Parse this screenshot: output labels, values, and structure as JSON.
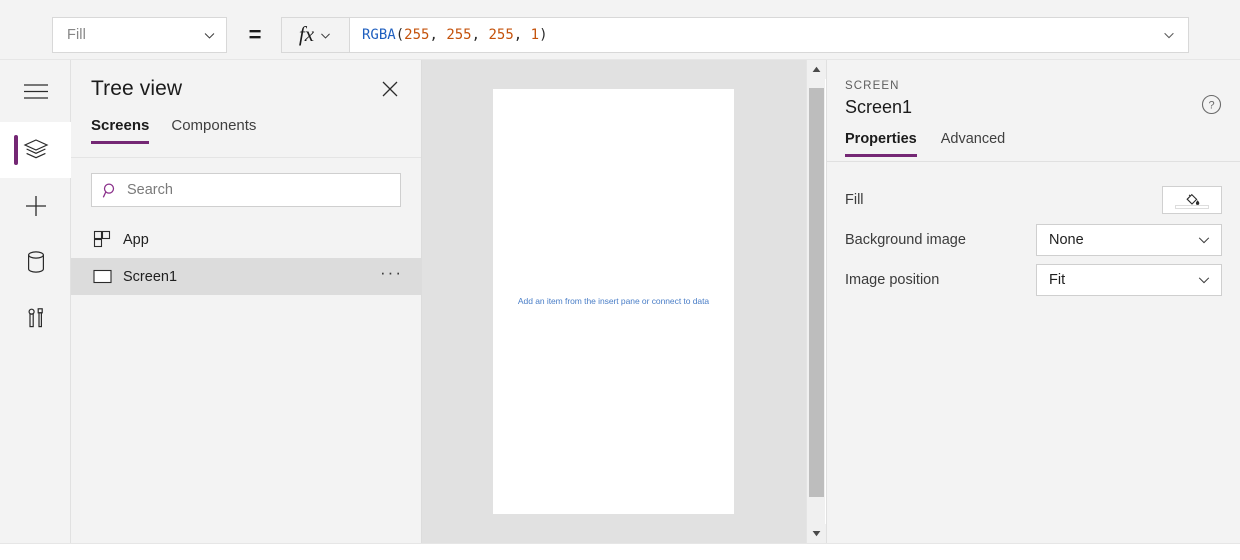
{
  "formula_bar": {
    "property_select": {
      "value": "Fill",
      "chevron_icon": "chevron-down-icon"
    },
    "equals": "=",
    "fx_label": "fx",
    "fx_chevron_icon": "chevron-down-icon",
    "formula": {
      "function_name": "RGBA",
      "open_paren": "(",
      "args": [
        "255",
        "255",
        "255",
        "1"
      ],
      "separator": ", ",
      "close_paren": ")",
      "full_text": "RGBA(255, 255, 255, 1)"
    },
    "expand_icon": "chevron-down-icon"
  },
  "rail": {
    "items": [
      {
        "name": "hamburger-icon",
        "label": "Menu",
        "active": false
      },
      {
        "name": "layers-icon",
        "label": "Tree view",
        "active": true
      },
      {
        "name": "plus-icon",
        "label": "Insert",
        "active": false
      },
      {
        "name": "database-icon",
        "label": "Data",
        "active": false
      },
      {
        "name": "tools-icon",
        "label": "Advanced tools",
        "active": false
      }
    ],
    "accent_color": "#742774"
  },
  "tree_view": {
    "title": "Tree view",
    "close_icon": "close-icon",
    "tabs": [
      {
        "label": "Screens",
        "active": true
      },
      {
        "label": "Components",
        "active": false
      }
    ],
    "search": {
      "placeholder": "Search",
      "value": "",
      "icon": "search-icon"
    },
    "items": [
      {
        "label": "App",
        "icon": "app-grid-icon",
        "selected": false,
        "overflow": ""
      },
      {
        "label": "Screen1",
        "icon": "screen-rect-icon",
        "selected": true,
        "overflow": "···"
      }
    ]
  },
  "canvas": {
    "hint_text": "Add an item from the insert pane or connect to data",
    "hint_color": "#4a7ec7",
    "background_color": "#e1e1e1",
    "screen_color": "#ffffff",
    "scrollbar": {
      "up_icon": "caret-up-icon",
      "down_icon": "caret-down-icon",
      "thumb": "scroll-thumb"
    }
  },
  "properties": {
    "kind": "SCREEN",
    "name": "Screen1",
    "help_icon": "help-circle-icon",
    "tabs": [
      {
        "label": "Properties",
        "active": true
      },
      {
        "label": "Advanced",
        "active": false
      }
    ],
    "rows": [
      {
        "label": "Fill",
        "control": "color",
        "value": "#ffffff",
        "icon": "paint-bucket-icon"
      },
      {
        "label": "Background image",
        "control": "dropdown",
        "value": "None"
      },
      {
        "label": "Image position",
        "control": "dropdown",
        "value": "Fit"
      }
    ]
  }
}
